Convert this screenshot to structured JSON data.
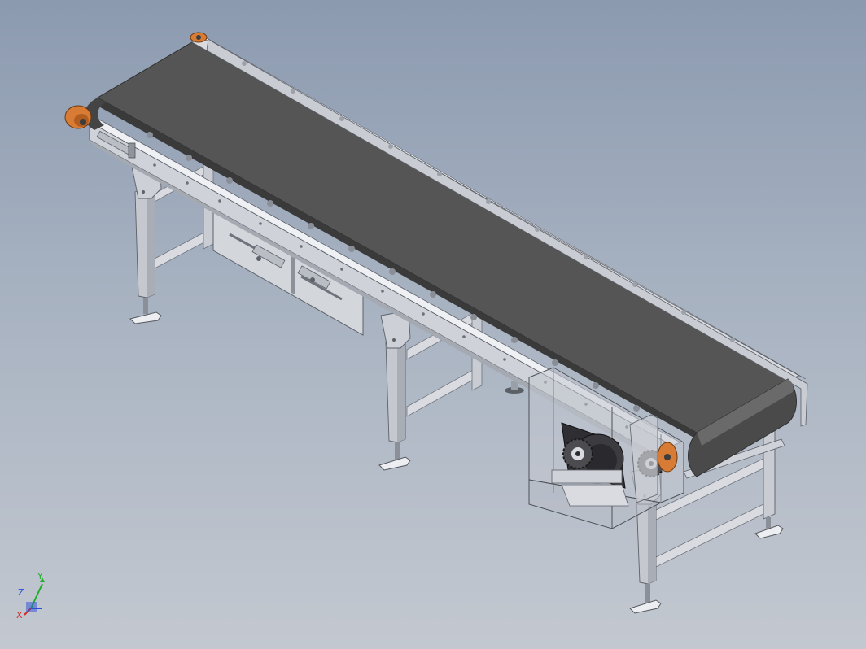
{
  "viewport": {
    "background_top": "#8c9ab0",
    "background_bottom": "#c3c8d0",
    "model": {
      "icon": "belt-conveyor-model",
      "belt_color": "#525252",
      "frame_color": "#d6d8dc",
      "accent_color": "#d77b35",
      "guard_color": "#b7bcc6"
    }
  },
  "triad": {
    "x_label": "X",
    "y_label": "Y",
    "z_label": "Z",
    "x_color": "#d62a2a",
    "y_color": "#1fae2a",
    "z_color": "#2a4fd6"
  }
}
